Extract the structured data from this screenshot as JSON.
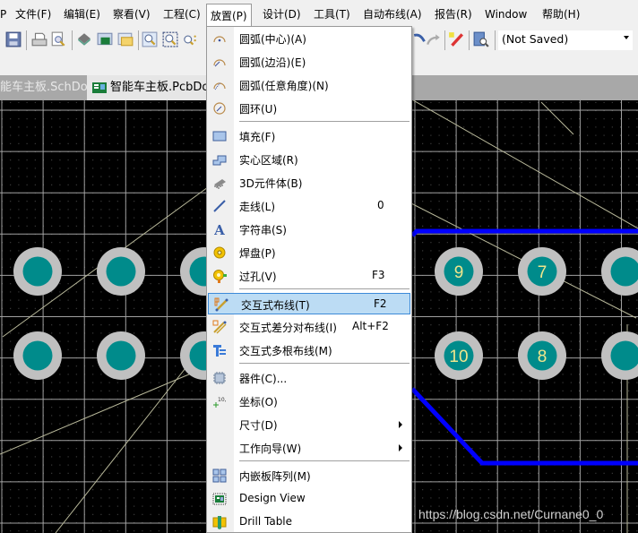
{
  "menubar": {
    "items": [
      {
        "label": "P"
      },
      {
        "label": "文件(F)"
      },
      {
        "label": "编辑(E)"
      },
      {
        "label": "察看(V)"
      },
      {
        "label": "工程(C)"
      },
      {
        "label": "放置(P)"
      },
      {
        "label": "设计(D)"
      },
      {
        "label": "工具(T)"
      },
      {
        "label": "自动布线(A)"
      },
      {
        "label": "报告(R)"
      },
      {
        "label": "Window"
      },
      {
        "label": "帮助(H)"
      }
    ],
    "open_menu": "放置(P)"
  },
  "toolbar": {
    "icons": [
      "save-icon",
      "print-icon",
      "print-preview-icon",
      "3d-component-icon",
      "pcb-board-icon",
      "folder-window-icon",
      "zoom-fit-icon",
      "zoom-area-icon",
      "zoom-selected-icon",
      "undo-icon",
      "redo-icon",
      "highlight-pen-icon",
      "inspect-icon"
    ],
    "variant_combo": {
      "value": "(Not Saved)"
    }
  },
  "tabs": [
    {
      "label": "能车主板.SchDoc *",
      "active": false
    },
    {
      "label": "智能车主板.PcbDoc",
      "active": true
    }
  ],
  "place_menu": {
    "items": [
      {
        "label": "圆弧(中心)(A)",
        "icon": "arc-center-icon",
        "shortcut": "",
        "submenu": false
      },
      {
        "label": "圆弧(边沿)(E)",
        "icon": "arc-edge-icon",
        "shortcut": "",
        "submenu": false
      },
      {
        "label": "圆弧(任意角度)(N)",
        "icon": "arc-any-angle-icon",
        "shortcut": "",
        "submenu": false
      },
      {
        "label": "圆环(U)",
        "icon": "full-circle-icon",
        "shortcut": "",
        "submenu": false
      },
      {
        "label": "填充(F)",
        "icon": "fill-icon",
        "shortcut": "",
        "submenu": false
      },
      {
        "label": "实心区域(R)",
        "icon": "solid-region-icon",
        "shortcut": "",
        "submenu": false
      },
      {
        "label": "3D元件体(B)",
        "icon": "3d-body-icon",
        "shortcut": "",
        "submenu": false
      },
      {
        "label": "走线(L)",
        "icon": "line-icon",
        "shortcut": "0",
        "submenu": false
      },
      {
        "label": "字符串(S)",
        "icon": "string-icon",
        "shortcut": "",
        "submenu": false
      },
      {
        "label": "焊盘(P)",
        "icon": "pad-icon",
        "shortcut": "",
        "submenu": false
      },
      {
        "label": "过孔(V)",
        "icon": "via-icon",
        "shortcut": "F3",
        "submenu": false
      },
      {
        "label": "交互式布线(T)",
        "icon": "interactive-routing-icon",
        "shortcut": "F2",
        "submenu": false,
        "highlighted": true
      },
      {
        "label": "交互式差分对布线(I)",
        "icon": "diff-pair-routing-icon",
        "shortcut": "Alt+F2",
        "submenu": false
      },
      {
        "label": "交互式多根布线(M)",
        "icon": "multi-routing-icon",
        "shortcut": "",
        "submenu": false
      },
      {
        "label": "器件(C)...",
        "icon": "component-icon",
        "shortcut": "",
        "submenu": false
      },
      {
        "label": "坐标(O)",
        "icon": "coordinate-icon",
        "shortcut": "",
        "submenu": false
      },
      {
        "label": "尺寸(D)",
        "icon": "",
        "shortcut": "",
        "submenu": true
      },
      {
        "label": "工作向导(W)",
        "icon": "",
        "shortcut": "",
        "submenu": true
      },
      {
        "label": "内嵌板阵列(M)",
        "icon": "embedded-board-array-icon",
        "shortcut": "",
        "submenu": false
      },
      {
        "label": "Design View",
        "icon": "design-view-icon",
        "shortcut": "",
        "submenu": false
      },
      {
        "label": "Drill Table",
        "icon": "drill-table-icon",
        "shortcut": "",
        "submenu": false
      }
    ],
    "coordinate_icon_text": "10,10"
  },
  "pcb": {
    "pad_labels": [
      "9",
      "7",
      "10",
      "8"
    ],
    "colors": {
      "background": "#000000",
      "grid": "#a0a0a0",
      "pad_ring": "#c0c0c0",
      "pad_hole": "#008b8b",
      "track": "#0000ff",
      "ratsnest": "#b8b89a",
      "pad_text": "#f0e68c"
    }
  },
  "watermark": "https://blog.csdn.net/Curnane0_0"
}
